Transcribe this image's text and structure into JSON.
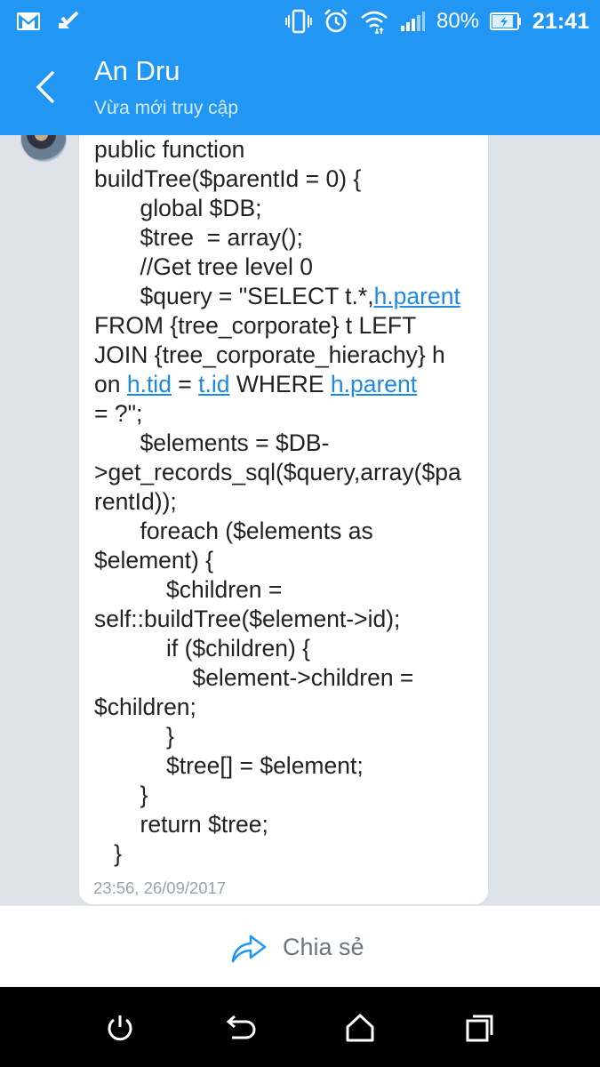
{
  "statusbar": {
    "battery_percent": "80%",
    "time": "21:41",
    "icons_left": [
      "gmail-icon",
      "app-check-icon"
    ],
    "icons_right": [
      "vibrate-icon",
      "alarm-icon",
      "wifi-icon",
      "signal-icon",
      "battery-icon"
    ]
  },
  "header": {
    "contact_name": "An Dru",
    "contact_status": "Vừa mới truy cập",
    "background_color": "#2196f3"
  },
  "message": {
    "lines": [
      [
        {
          "t": "public function"
        }
      ],
      [
        {
          "t": "buildTree($parentId = 0) {"
        }
      ],
      [
        {
          "t": "       global $DB;"
        }
      ],
      [
        {
          "t": "       $tree  = array();"
        }
      ],
      [
        {
          "t": "       //Get tree level 0"
        }
      ],
      [
        {
          "t": "       $query = \"SELECT t.*,"
        },
        {
          "t": "h.parent",
          "link": true
        }
      ],
      [
        {
          "t": "FROM {tree_corporate} t LEFT"
        }
      ],
      [
        {
          "t": "JOIN {tree_corporate_hierachy} h"
        }
      ],
      [
        {
          "t": "on "
        },
        {
          "t": "h.tid",
          "link": true
        },
        {
          "t": " = "
        },
        {
          "t": "t.id",
          "link": true
        },
        {
          "t": " WHERE "
        },
        {
          "t": "h.parent",
          "link": true
        }
      ],
      [
        {
          "t": "= ?\";"
        }
      ],
      [
        {
          "t": "       $elements = $DB-"
        }
      ],
      [
        {
          "t": ">get_records_sql($query,array($pa"
        }
      ],
      [
        {
          "t": "rentId));"
        }
      ],
      [
        {
          "t": "       foreach ($elements as"
        }
      ],
      [
        {
          "t": "$element) {"
        }
      ],
      [
        {
          "t": "           $children ="
        }
      ],
      [
        {
          "t": "self::buildTree($element->id);"
        }
      ],
      [
        {
          "t": "           if ($children) {"
        }
      ],
      [
        {
          "t": "               $element->children ="
        }
      ],
      [
        {
          "t": "$children;"
        }
      ],
      [
        {
          "t": "           }"
        }
      ],
      [
        {
          "t": "           $tree[] = $element;"
        }
      ],
      [
        {
          "t": "       }"
        }
      ],
      [
        {
          "t": "       return $tree;"
        }
      ],
      [
        {
          "t": "   }"
        }
      ]
    ],
    "timestamp": "23:56, 26/09/2017",
    "link_color": "#1e88e5"
  },
  "sharebar": {
    "label": "Chia sẻ",
    "icon": "share-arrow-icon"
  },
  "navbar": {
    "buttons": [
      "power-icon",
      "back-icon",
      "home-icon",
      "recents-icon"
    ]
  }
}
